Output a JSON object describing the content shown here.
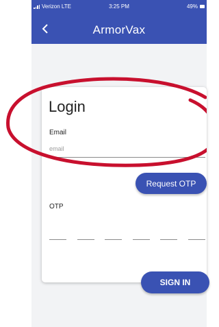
{
  "status_bar": {
    "carrier": "Verizon  LTE",
    "time": "3:25 PM",
    "battery": "49%"
  },
  "app_bar": {
    "title": "ArmorVax"
  },
  "login": {
    "heading": "Login",
    "email_label": "Email",
    "email_placeholder": "email",
    "request_otp_label": "Request OTP",
    "otp_label": "OTP",
    "otp_digits": 6,
    "sign_in_label": "SIGN IN"
  },
  "colors": {
    "primary": "#3a52b3",
    "annotation": "#c8102e"
  },
  "icons": {
    "back": "chevron-left-icon",
    "signal": "signal-bars-icon",
    "battery": "battery-icon"
  },
  "annotation": {
    "shape": "hand-drawn-ellipse",
    "highlights": "login-heading-and-email-field"
  }
}
